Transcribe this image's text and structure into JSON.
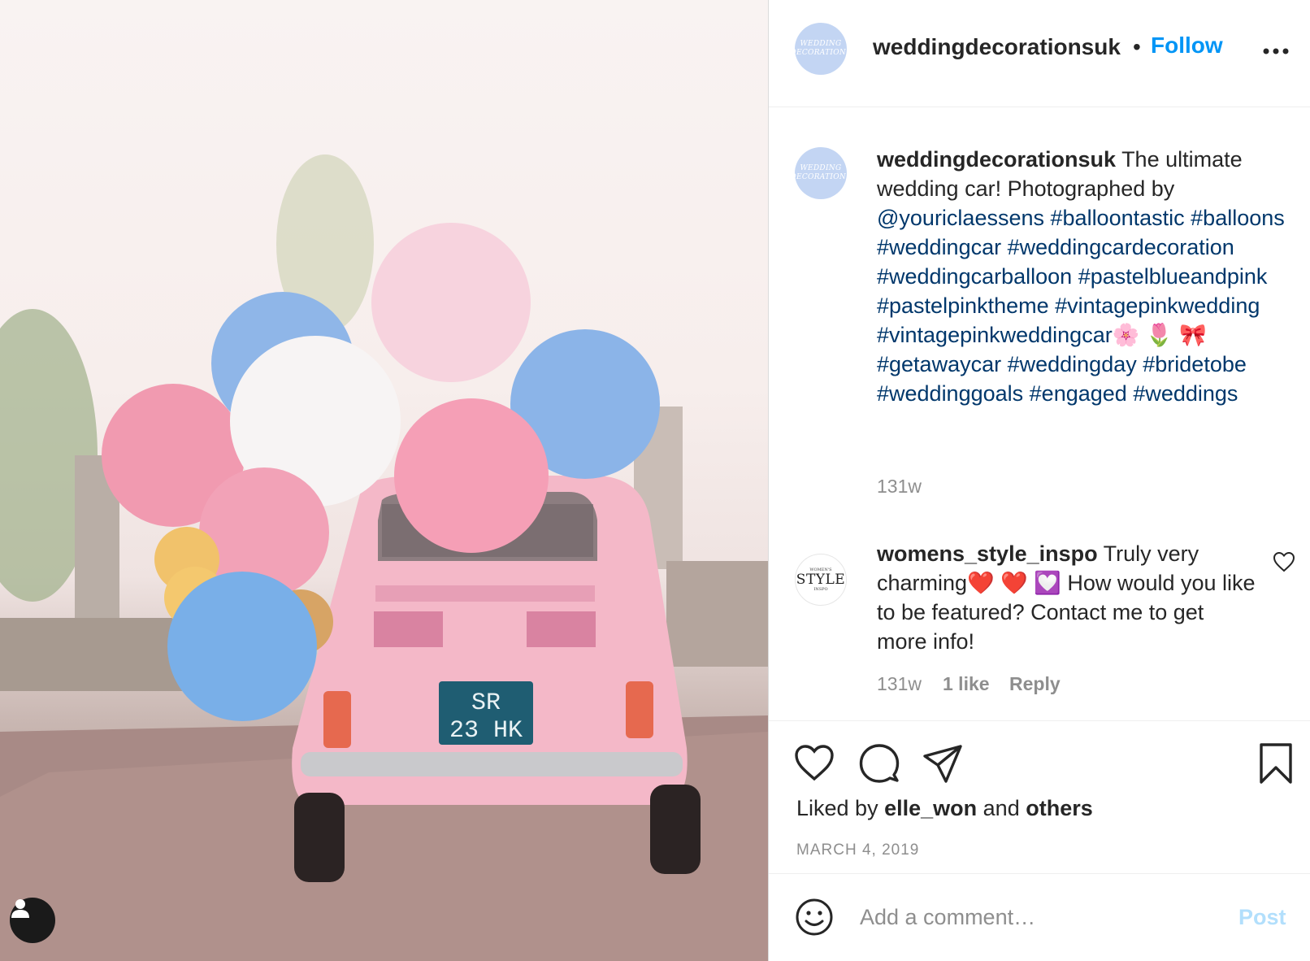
{
  "post": {
    "username": "weddingdecorationsuk",
    "separator": "•",
    "follow_label": "Follow",
    "avatar_text_line1": "WEDDING",
    "avatar_text_line2": "DECORATIONS",
    "photo": {
      "license_plate_line1": "SR",
      "license_plate_line2": "23 HK",
      "user_tag_icon": "person-icon"
    },
    "caption": {
      "text_1": "The ultimate wedding car! Photographed by ",
      "mention": "@youriclaessens",
      "tags_1": [
        "#balloontastic",
        "#balloons",
        "#weddingcar",
        "#weddingcardecoration",
        "#weddingcarballoon",
        "#pastelblueandpink",
        "#pastelpinktheme",
        "#vintagepinkwedding",
        "#vintagepinkweddingcar"
      ],
      "emojis": "🌸 🌷 🎀",
      "tags_2": [
        "#getawaycar",
        "#weddingday",
        "#bridetobe",
        "#weddinggoals",
        "#engaged",
        "#weddings"
      ],
      "time": "131w"
    },
    "comment": {
      "username": "womens_style_inspo",
      "avatar_small_top": "WOMEN'S",
      "avatar_big": "STYLE",
      "avatar_small_bottom": "INSPO",
      "text_1": "Truly very charming",
      "emojis": "❤️ ❤️ 💟",
      "text_2": "How would you like to be featured? Contact me to get more info!",
      "time": "131w",
      "likes": "1 like",
      "reply_label": "Reply"
    },
    "likes": {
      "prefix": "Liked by",
      "user": "elle_won",
      "mid": "and",
      "others": "others"
    },
    "date": "MARCH 4, 2019",
    "add_comment": {
      "placeholder": "Add a comment…",
      "post_label": "Post"
    },
    "colors": {
      "accent": "#0095f6",
      "hashtag": "#00376b",
      "muted": "#8e8e8e",
      "post_disabled": "#b2dffc",
      "car_pink": "#f4b8c8"
    }
  }
}
